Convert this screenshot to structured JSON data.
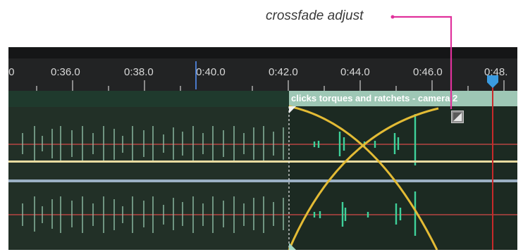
{
  "callout": {
    "label": "crossfade adjust"
  },
  "ruler": {
    "labels": [
      ".0",
      "0:36.0",
      "0:38.0",
      "0:40.0",
      "0:42.0",
      "0:44.0",
      "0:46.0",
      "0:48."
    ]
  },
  "clip": {
    "title": "clicks torques and ratchets - camera 2"
  },
  "colors": {
    "callout_line": "#e0319c",
    "crossfade_curve": "#e3bb35",
    "playhead": "#c72a2a",
    "playhead_marker": "#3a9be0",
    "clip_header": "#9ec7b5",
    "waveform": "#3fd19a",
    "track_line": "#d64a4a",
    "audio_bar": "#e8dba0"
  },
  "icons": {
    "crossfade_adjust": "crossfade-adjust-icon",
    "playhead_marker": "playhead-marker-icon",
    "fade_handle": "fade-handle-icon"
  }
}
